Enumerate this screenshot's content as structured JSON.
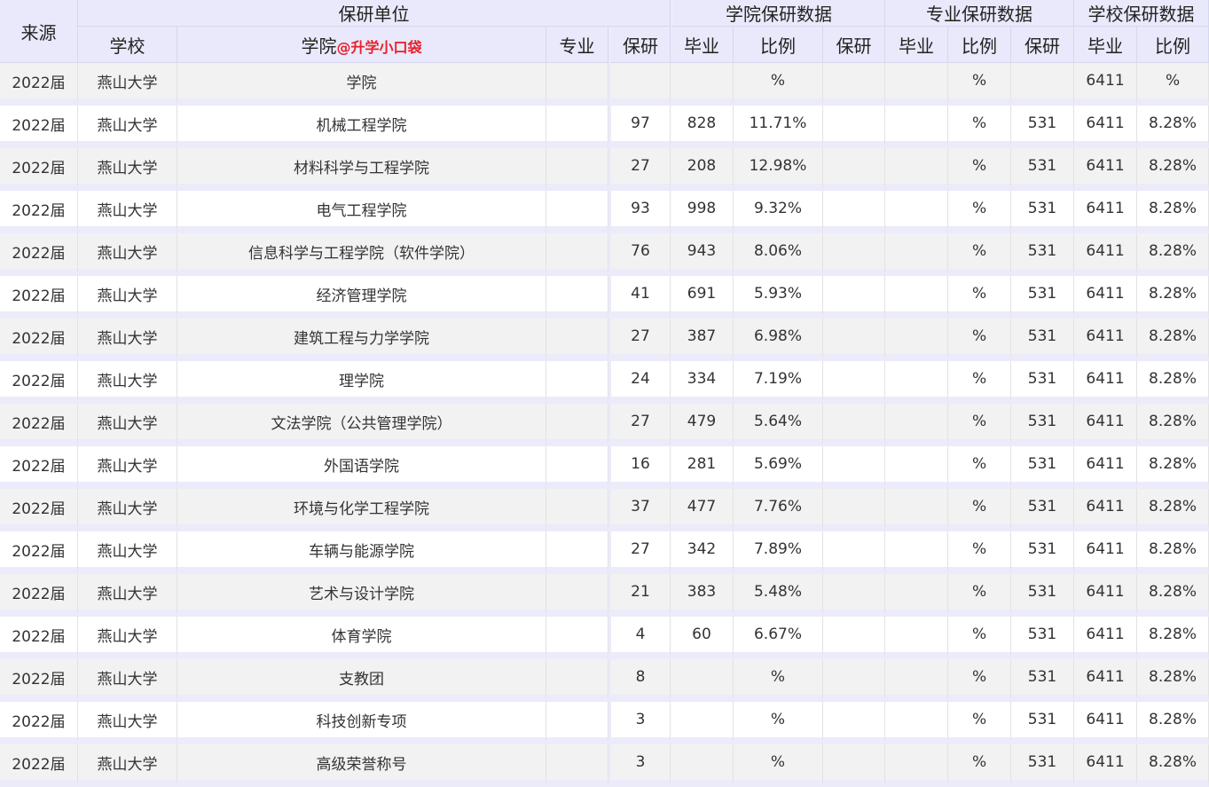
{
  "header": {
    "source": "来源",
    "unit_group": "保研单位",
    "college_group": "学院保研数据",
    "major_group": "专业保研数据",
    "school_group": "学校保研数据",
    "school": "学校",
    "college": "学院",
    "watermark": "@升学小口袋",
    "major": "专业",
    "cols": [
      "保研",
      "毕业",
      "比例",
      "保研",
      "毕业",
      "比例",
      "保研",
      "毕业",
      "比例"
    ]
  },
  "rows": [
    [
      "2022届",
      "燕山大学",
      "学院",
      "",
      "",
      "",
      "%",
      "",
      "",
      "%",
      "",
      "6411",
      "%"
    ],
    [
      "2022届",
      "燕山大学",
      "机械工程学院",
      "",
      "97",
      "828",
      "11.71%",
      "",
      "",
      "%",
      "531",
      "6411",
      "8.28%"
    ],
    [
      "2022届",
      "燕山大学",
      "材料科学与工程学院",
      "",
      "27",
      "208",
      "12.98%",
      "",
      "",
      "%",
      "531",
      "6411",
      "8.28%"
    ],
    [
      "2022届",
      "燕山大学",
      "电气工程学院",
      "",
      "93",
      "998",
      "9.32%",
      "",
      "",
      "%",
      "531",
      "6411",
      "8.28%"
    ],
    [
      "2022届",
      "燕山大学",
      "信息科学与工程学院（软件学院）",
      "",
      "76",
      "943",
      "8.06%",
      "",
      "",
      "%",
      "531",
      "6411",
      "8.28%"
    ],
    [
      "2022届",
      "燕山大学",
      "经济管理学院",
      "",
      "41",
      "691",
      "5.93%",
      "",
      "",
      "%",
      "531",
      "6411",
      "8.28%"
    ],
    [
      "2022届",
      "燕山大学",
      "建筑工程与力学学院",
      "",
      "27",
      "387",
      "6.98%",
      "",
      "",
      "%",
      "531",
      "6411",
      "8.28%"
    ],
    [
      "2022届",
      "燕山大学",
      "理学院",
      "",
      "24",
      "334",
      "7.19%",
      "",
      "",
      "%",
      "531",
      "6411",
      "8.28%"
    ],
    [
      "2022届",
      "燕山大学",
      "文法学院（公共管理学院）",
      "",
      "27",
      "479",
      "5.64%",
      "",
      "",
      "%",
      "531",
      "6411",
      "8.28%"
    ],
    [
      "2022届",
      "燕山大学",
      "外国语学院",
      "",
      "16",
      "281",
      "5.69%",
      "",
      "",
      "%",
      "531",
      "6411",
      "8.28%"
    ],
    [
      "2022届",
      "燕山大学",
      "环境与化学工程学院",
      "",
      "37",
      "477",
      "7.76%",
      "",
      "",
      "%",
      "531",
      "6411",
      "8.28%"
    ],
    [
      "2022届",
      "燕山大学",
      "车辆与能源学院",
      "",
      "27",
      "342",
      "7.89%",
      "",
      "",
      "%",
      "531",
      "6411",
      "8.28%"
    ],
    [
      "2022届",
      "燕山大学",
      "艺术与设计学院",
      "",
      "21",
      "383",
      "5.48%",
      "",
      "",
      "%",
      "531",
      "6411",
      "8.28%"
    ],
    [
      "2022届",
      "燕山大学",
      "体育学院",
      "",
      "4",
      "60",
      "6.67%",
      "",
      "",
      "%",
      "531",
      "6411",
      "8.28%"
    ],
    [
      "2022届",
      "燕山大学",
      "支教团",
      "",
      "8",
      "",
      "%",
      "",
      "",
      "%",
      "531",
      "6411",
      "8.28%"
    ],
    [
      "2022届",
      "燕山大学",
      "科技创新专项",
      "",
      "3",
      "",
      "%",
      "",
      "",
      "%",
      "531",
      "6411",
      "8.28%"
    ],
    [
      "2022届",
      "燕山大学",
      "高级荣誉称号",
      "",
      "3",
      "",
      "%",
      "",
      "",
      "%",
      "531",
      "6411",
      "8.28%"
    ]
  ]
}
